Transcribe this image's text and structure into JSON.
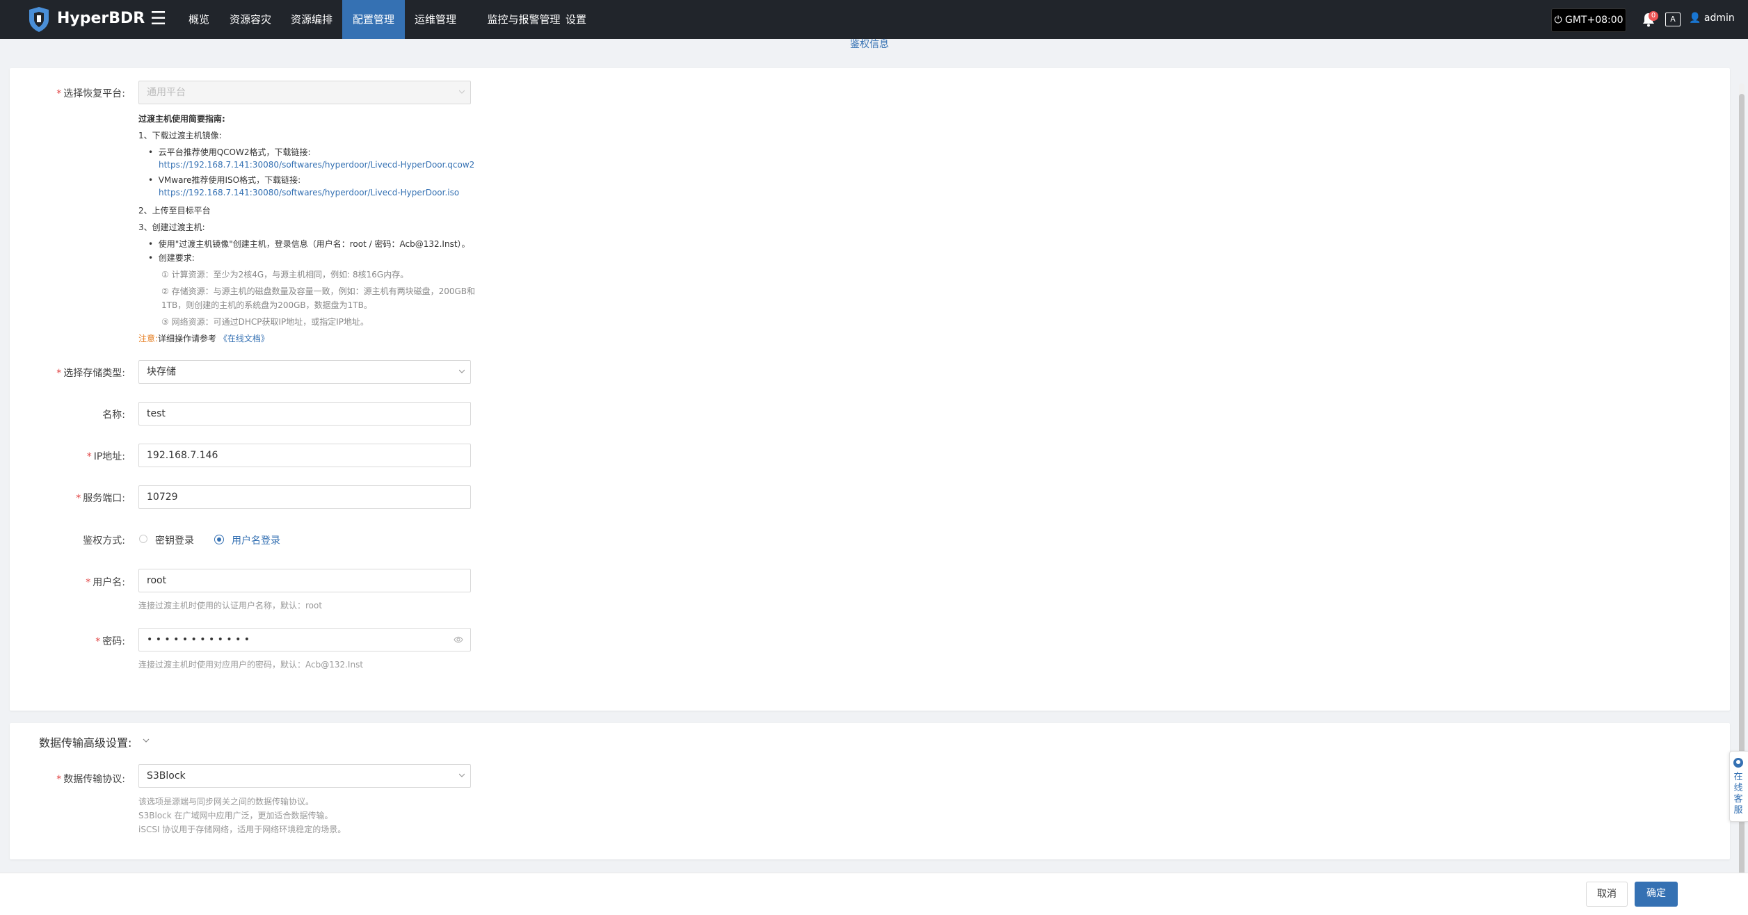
{
  "topbar": {
    "brand": "HyperBDR",
    "nav": [
      "概览",
      "资源容灾",
      "资源编排",
      "配置管理",
      "运维管理",
      "监控与报警管理",
      "设置"
    ],
    "active_nav": "配置管理",
    "timezone": "GMT+08:00",
    "notification_count": "0",
    "lang_icon_text": "A",
    "user": "admin"
  },
  "stepper_link": "鉴权信息",
  "form": {
    "platform": {
      "label": "选择恢复平台:",
      "placeholder": "通用平台"
    },
    "guide": {
      "title": "过渡主机使用简要指南:",
      "step1": "1、下载过渡主机镜像:",
      "step1_a": "云平台推荐使用QCOW2格式，下载链接:",
      "step1_a_link": "https://192.168.7.141:30080/softwares/hyperdoor/Livecd-HyperDoor.qcow2",
      "step1_b": "VMware推荐使用ISO格式，下载链接:",
      "step1_b_link": "https://192.168.7.141:30080/softwares/hyperdoor/Livecd-HyperDoor.iso",
      "step2": "2、上传至目标平台",
      "step3": "3、创建过渡主机:",
      "step3_a": "使用\"过渡主机镜像\"创建主机，登录信息（用户名：root / 密码：Acb@132.Inst）。",
      "step3_b": "创建要求:",
      "req1": "① 计算资源：至少为2核4G，与源主机相同，例如: 8核16G内存。",
      "req2_line1": "② 存储资源：与源主机的磁盘数量及容量一致，例如：源主机有两块磁盘，200GB和",
      "req2_line2": "1TB，则创建的主机的系统盘为200GB，数据盘为1TB。",
      "req3": "③ 网络资源：可通过DHCP获取IP地址，或指定IP地址。",
      "note_prefix": "注意:",
      "note_text": "详细操作请参考",
      "note_link": "《在线文档》"
    },
    "storage_type": {
      "label": "选择存储类型:",
      "value": "块存储"
    },
    "name": {
      "label": "名称:",
      "value": "test"
    },
    "ip": {
      "label": "IP地址:",
      "value": "192.168.7.146"
    },
    "port": {
      "label": "服务端口:",
      "value": "10729"
    },
    "auth": {
      "label": "鉴权方式:",
      "option_key": "密钥登录",
      "option_user": "用户名登录",
      "selected": "用户名登录"
    },
    "username": {
      "label": "用户名:",
      "value": "root",
      "help": "连接过渡主机时使用的认证用户名称，默认：root"
    },
    "password": {
      "label": "密码:",
      "value": "• • • • • • • • • • • •",
      "help": "连接过渡主机时使用对应用户的密码，默认：Acb@132.Inst"
    }
  },
  "advanced": {
    "title": "数据传输高级设置:",
    "protocol": {
      "label": "数据传输协议:",
      "value": "S3Block"
    },
    "help1": "该选项是源端与同步网关之间的数据传输协议。",
    "help2": "S3Block 在广域网中应用广泛，更加适合数据传输。",
    "help3": "iSCSI 协议用于存储网络，适用于网络环境稳定的场景。"
  },
  "footer": {
    "cancel": "取消",
    "confirm": "确定"
  },
  "side_widget": {
    "text": "在线客服"
  },
  "colors": {
    "primary": "#3571b3",
    "topbar": "#21252b",
    "required": "#e14444",
    "warning": "#e67e22"
  }
}
